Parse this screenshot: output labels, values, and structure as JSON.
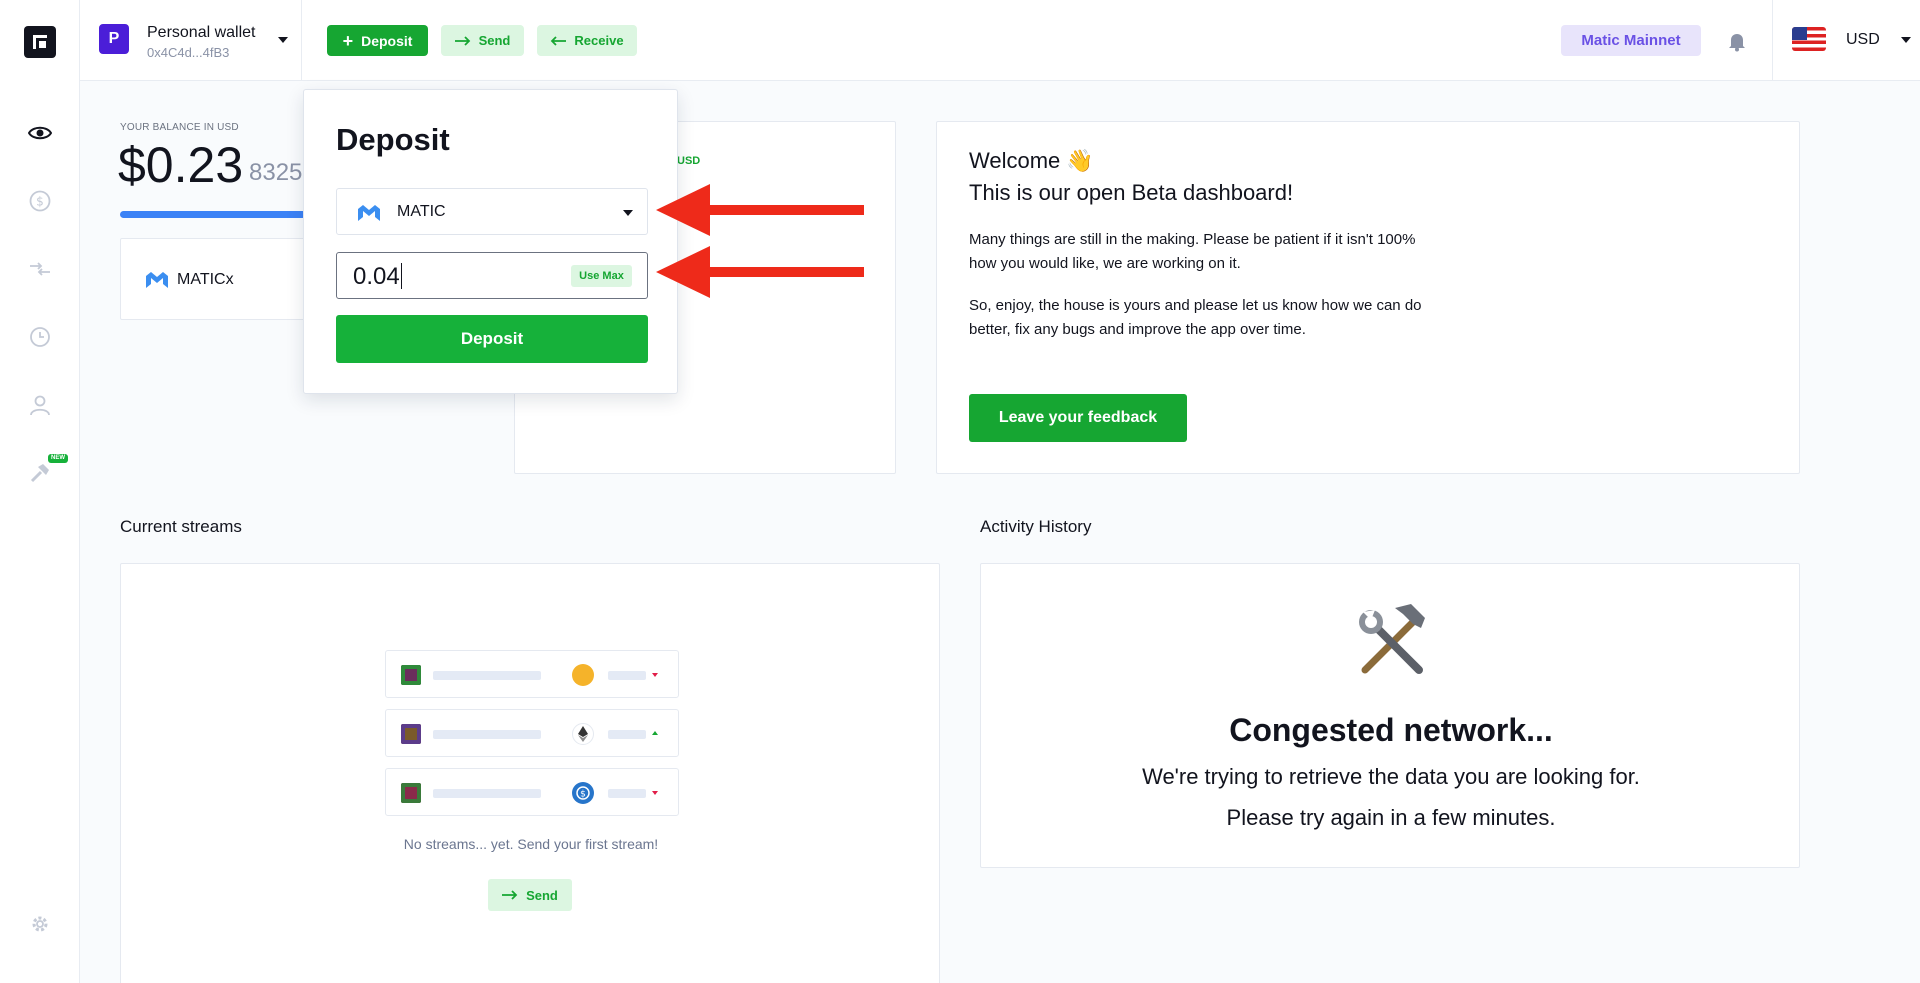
{
  "sidebar": {
    "items": [
      {
        "name": "eye-icon"
      },
      {
        "name": "dollar-icon"
      },
      {
        "name": "transfer-arrows-icon"
      },
      {
        "name": "history-clock-icon"
      },
      {
        "name": "user-icon"
      },
      {
        "name": "hammer-icon",
        "badge": "NEW"
      },
      {
        "name": "gear-icon"
      }
    ]
  },
  "header": {
    "wallet": {
      "avatar_letter": "P",
      "name": "Personal wallet",
      "address": "0x4C4d...4fB3"
    },
    "actions": {
      "deposit": "Deposit",
      "send": "Send",
      "receive": "Receive"
    },
    "network": "Matic Mainnet",
    "currency": "USD"
  },
  "balance": {
    "label": "YOUR BALANCE IN USD",
    "main": "$0.23",
    "decimals": "8325",
    "token_card": {
      "name": "MATICx"
    },
    "usd_card_tag": "USD"
  },
  "welcome": {
    "title": "Welcome",
    "subtitle": "This is our open Beta dashboard!",
    "p1": "Many things are still in the making. Please be patient if it isn't 100% how you would like, we are working on it.",
    "p2": "So, enjoy, the house is yours and please let us know how we can do better, fix any bugs and improve the app over time.",
    "button": "Leave your feedback"
  },
  "streams": {
    "title": "Current streams",
    "empty_text": "No streams... yet. Send your first stream!",
    "send_button": "Send"
  },
  "activity": {
    "title": "Activity History",
    "heading": "Congested network...",
    "line1": "We're trying to retrieve the data you are looking for.",
    "line2": "Please try again in a few minutes."
  },
  "deposit_popup": {
    "title": "Deposit",
    "token": "MATIC",
    "amount": "0.04",
    "use_max": "Use Max",
    "button": "Deposit"
  },
  "colors": {
    "accent_green": "#16a632",
    "network_purple": "#6a51e5",
    "arrow_red": "#ee2a1a"
  }
}
